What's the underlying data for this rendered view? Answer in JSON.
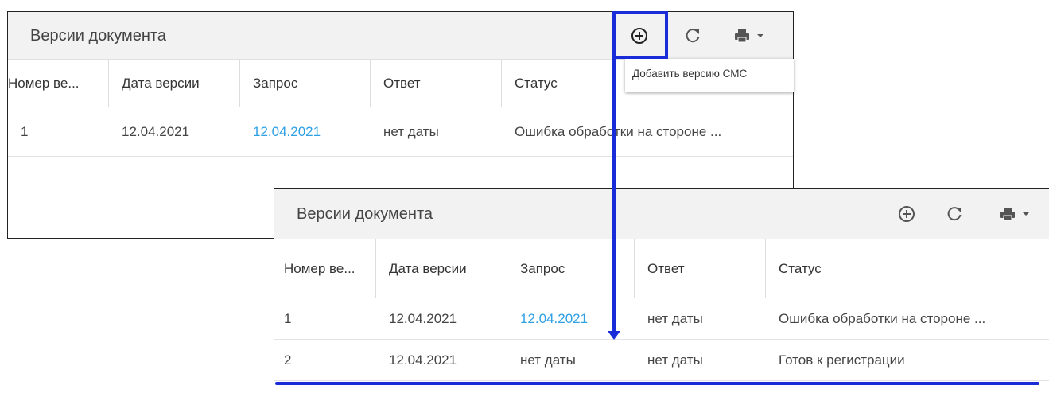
{
  "panel_before": {
    "title": "Версии документа",
    "columns": [
      "Номер ве...",
      "Дата версии",
      "Запрос",
      "Ответ",
      "Статус"
    ],
    "rows": [
      {
        "number": "1",
        "version_date": "12.04.2021",
        "request": "12.04.2021",
        "response": "нет даты",
        "status": "Ошибка обработки на стороне ..."
      }
    ]
  },
  "tooltip": {
    "text": "Добавить версию СМС"
  },
  "panel_after": {
    "title": "Версии документа",
    "columns": [
      "Номер ве...",
      "Дата версии",
      "Запрос",
      "Ответ",
      "Статус"
    ],
    "rows": [
      {
        "number": "1",
        "version_date": "12.04.2021",
        "request": "12.04.2021",
        "response": "нет даты",
        "status": "Ошибка обработки на стороне ..."
      },
      {
        "number": "2",
        "version_date": "12.04.2021",
        "request": "нет даты",
        "response": "нет даты",
        "status": "Готов к регистрации"
      }
    ]
  },
  "icons": {
    "add": "plus-circle-icon",
    "refresh": "refresh-icon",
    "print": "printer-icon",
    "dropdown": "caret-down-icon"
  },
  "colors": {
    "annotation": "#1a2bd8",
    "link": "#2fa0e4",
    "header_bg": "#f2f2f2"
  }
}
